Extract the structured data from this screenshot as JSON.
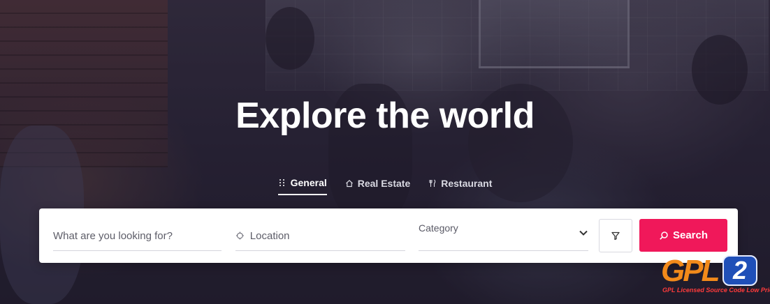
{
  "hero": {
    "title": "Explore the world"
  },
  "tabs": [
    {
      "label": "General",
      "icon": "grid-dots-icon",
      "active": true
    },
    {
      "label": "Real Estate",
      "icon": "house-icon",
      "active": false
    },
    {
      "label": "Restaurant",
      "icon": "fork-knife-icon",
      "active": false
    }
  ],
  "search": {
    "keyword_placeholder": "What are you looking for?",
    "location_placeholder": "Location",
    "category_label": "Category",
    "button_label": "Search"
  },
  "watermark": {
    "letters": "GPL",
    "badge": "2",
    "tagline": "GPL Licensed Source Code Low Price"
  },
  "colors": {
    "accent": "#f0185a",
    "panel": "#ffffff",
    "title": "#ffffff"
  }
}
